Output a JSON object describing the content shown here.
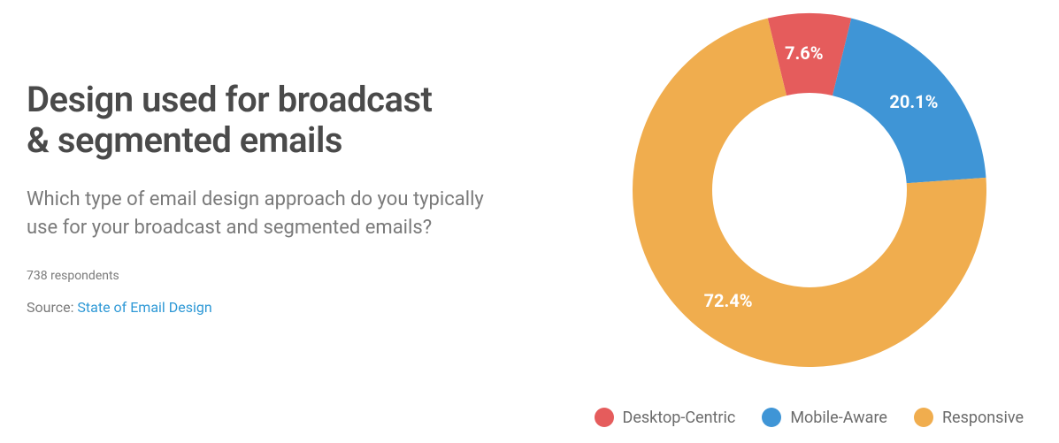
{
  "title_line1": "Design used for broadcast",
  "title_line2": "& segmented emails",
  "question": "Which type of email design approach do you typically use for your broadcast and segmented emails?",
  "respondents": "738 respondents",
  "source_label": "Source: ",
  "source_link_text": "State of Email Design",
  "chart_data": {
    "type": "pie",
    "title": "Design used for broadcast & segmented emails",
    "series": [
      {
        "name": "Desktop-Centric",
        "value": 7.6,
        "label": "7.6%",
        "color": "#e55c5c"
      },
      {
        "name": "Mobile-Aware",
        "value": 20.1,
        "label": "20.1%",
        "color": "#3f95d6"
      },
      {
        "name": "Responsive",
        "value": 72.4,
        "label": "72.4%",
        "color": "#f0ad4e"
      }
    ]
  }
}
